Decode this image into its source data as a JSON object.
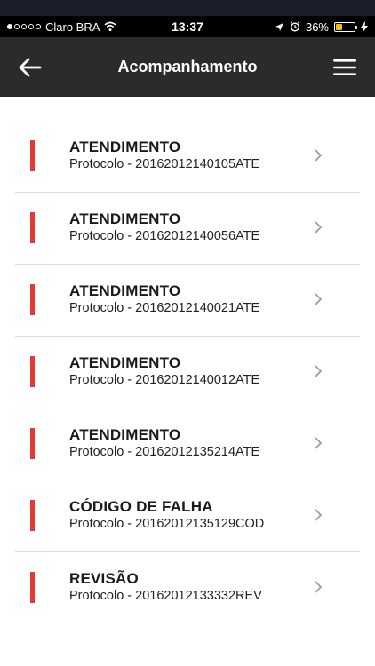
{
  "status_bar": {
    "carrier": "Claro BRA",
    "time": "13:37",
    "battery": "36%",
    "battery_level": 0.36
  },
  "navbar": {
    "title": "Acompanhamento",
    "back_icon": "arrow-left-icon",
    "menu_icon": "hamburger-menu-icon"
  },
  "items": [
    {
      "title": "ATENDIMENTO",
      "subtitle": "Protocolo - 20162012140105ATE"
    },
    {
      "title": "ATENDIMENTO",
      "subtitle": "Protocolo - 20162012140056ATE"
    },
    {
      "title": "ATENDIMENTO",
      "subtitle": "Protocolo - 20162012140021ATE"
    },
    {
      "title": "ATENDIMENTO",
      "subtitle": "Protocolo - 20162012140012ATE"
    },
    {
      "title": "ATENDIMENTO",
      "subtitle": "Protocolo - 20162012135214ATE"
    },
    {
      "title": "CÓDIGO DE FALHA",
      "subtitle": "Protocolo - 20162012135129COD"
    },
    {
      "title": "REVISÃO",
      "subtitle": "Protocolo - 20162012133332REV"
    }
  ],
  "colors": {
    "navbar_bg": "#2b2b2b",
    "marker": "#e53935",
    "battery": "#f5c400"
  }
}
